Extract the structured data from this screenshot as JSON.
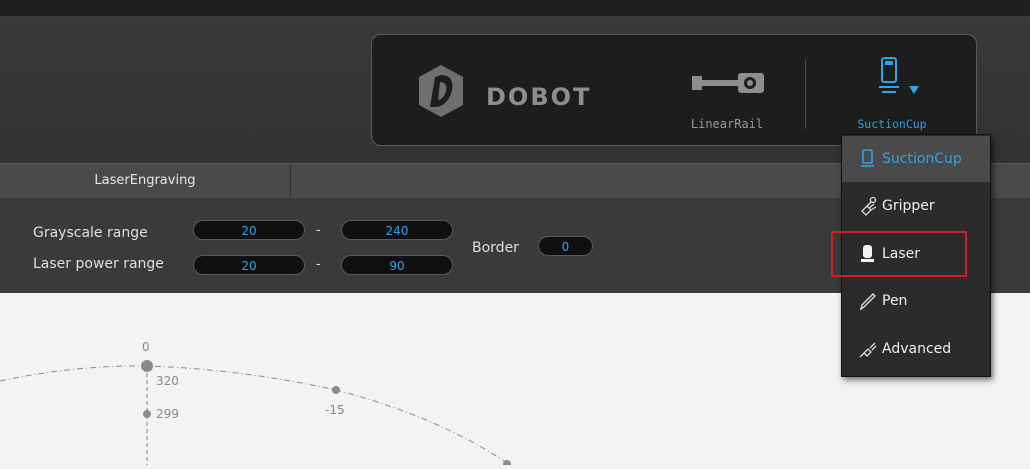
{
  "header": {
    "logo_text": "DOBOT",
    "devices": [
      {
        "label": "LinearRail",
        "icon": "linear-rail-icon"
      },
      {
        "label": "SuctionCup",
        "icon": "suction-cup-icon"
      }
    ]
  },
  "section": {
    "title": "LaserEngraving"
  },
  "params": {
    "grayscale_label": "Grayscale  range",
    "grayscale_min": "20",
    "grayscale_max": "240",
    "laser_power_label": "Laser power range",
    "laser_power_min": "20",
    "laser_power_max": "90",
    "dash": "-",
    "border_label": "Border",
    "border_value": "0"
  },
  "end_tool_menu": {
    "items": [
      {
        "label": "SuctionCup",
        "icon": "suction-cup-icon",
        "selected": true
      },
      {
        "label": "Gripper",
        "icon": "gripper-icon"
      },
      {
        "label": "Laser",
        "icon": "laser-icon",
        "highlighted": true
      },
      {
        "label": "Pen",
        "icon": "pen-icon"
      },
      {
        "label": "Advanced",
        "icon": "advanced-icon"
      }
    ]
  },
  "canvas": {
    "labels": [
      "0",
      "320",
      "299",
      "-15"
    ]
  },
  "colors": {
    "accent": "#2fa3e5",
    "highlight_border": "#d01f1f",
    "panel_bg": "#1d1d1d"
  }
}
